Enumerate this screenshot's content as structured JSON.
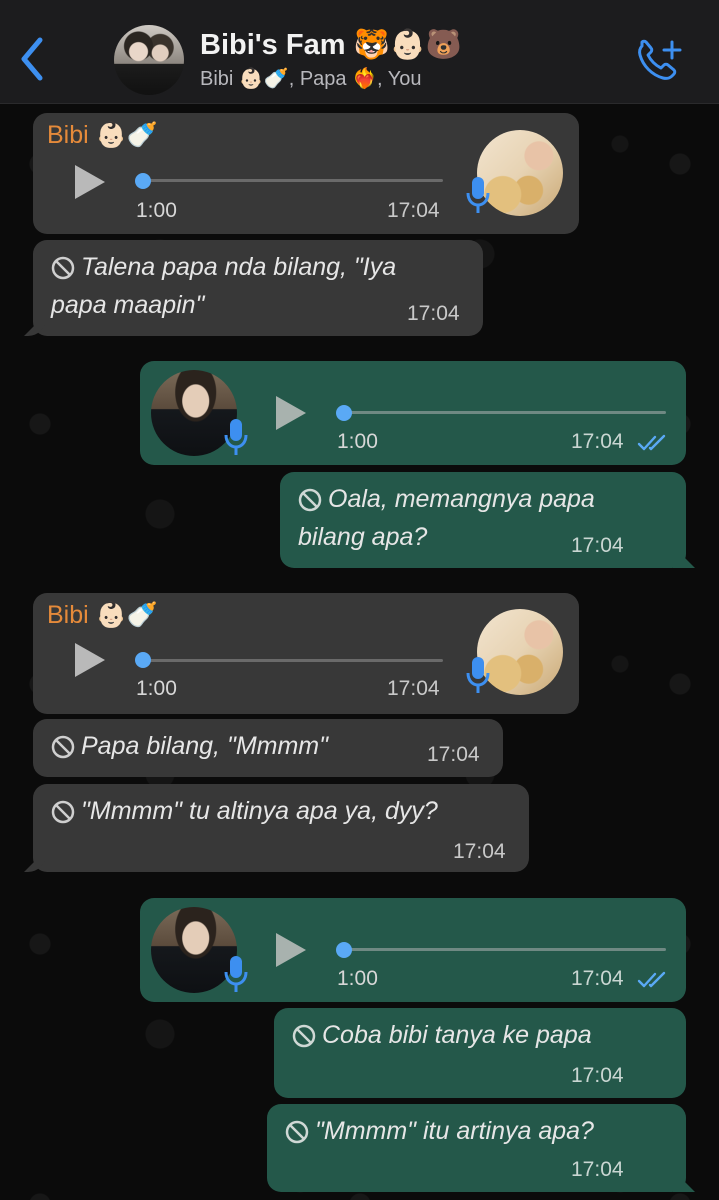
{
  "header": {
    "title": "Bibi's Fam 🐯👶🏻🐻",
    "members": "Bibi 👶🏻🍼, Papa ❤️‍🔥, You"
  },
  "colors": {
    "accent": "#3d8ff0",
    "sender_name": "#e58a3a",
    "incoming_bubble": "#383838",
    "outgoing_bubble": "#24584a",
    "audio_progress": "#5aa9f5"
  },
  "messages": [
    {
      "type": "voice",
      "direction": "in",
      "sender": "Bibi 👶🏻🍼",
      "duration": "1:00",
      "time": "17:04",
      "progress": 0
    },
    {
      "type": "deleted",
      "direction": "in",
      "lines": [
        "Talena papa nda bilang, \"Iya",
        "papa maapin\""
      ],
      "time": "17:04"
    },
    {
      "type": "voice",
      "direction": "out",
      "duration": "1:00",
      "time": "17:04",
      "progress": 0,
      "status": "read"
    },
    {
      "type": "deleted",
      "direction": "out",
      "lines": [
        "Oala, memangnya papa",
        "bilang apa?"
      ],
      "time": "17:04"
    },
    {
      "type": "voice",
      "direction": "in",
      "sender": "Bibi 👶🏻🍼",
      "duration": "1:00",
      "time": "17:04",
      "progress": 0
    },
    {
      "type": "deleted",
      "direction": "in",
      "lines": [
        "Papa bilang, \"Mmmm\""
      ],
      "time": "17:04"
    },
    {
      "type": "deleted",
      "direction": "in",
      "lines": [
        "\"Mmmm\" tu altinya apa ya, dyy?"
      ],
      "time": "17:04"
    },
    {
      "type": "voice",
      "direction": "out",
      "duration": "1:00",
      "time": "17:04",
      "progress": 0,
      "status": "read"
    },
    {
      "type": "deleted",
      "direction": "out",
      "lines": [
        "Coba bibi tanya ke papa"
      ],
      "time": "17:04"
    },
    {
      "type": "deleted",
      "direction": "out",
      "lines": [
        "\"Mmmm\" itu artinya apa?"
      ],
      "time": "17:04"
    }
  ],
  "icons": [
    "back-chevron-icon",
    "group-avatar",
    "add-call-icon",
    "play-icon",
    "microphone-icon",
    "deleted-ban-icon",
    "double-check-icon"
  ]
}
